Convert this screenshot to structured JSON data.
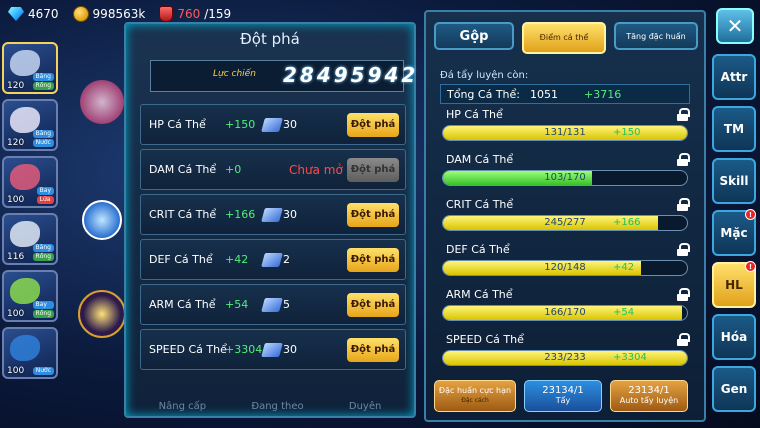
{
  "topbar": {
    "gems": "4670",
    "gold": "998563k",
    "stamina": "760",
    "stamina_max": "/159"
  },
  "heroes": [
    {
      "level": "120",
      "tags": [
        "Băng",
        "Rồng"
      ],
      "color": "#c6d6f2",
      "selected": true
    },
    {
      "level": "120",
      "tags": [
        "Băng",
        "Nước"
      ],
      "color": "#e9e6f9",
      "selected": false
    },
    {
      "level": "100",
      "tags": [
        "Bay",
        "Lửa"
      ],
      "color": "#e05a7a",
      "selected": false
    },
    {
      "level": "116",
      "tags": [
        "Băng",
        "Rồng"
      ],
      "color": "#dfe7f5",
      "selected": false
    },
    {
      "level": "100",
      "tags": [
        "Bay",
        "Rồng"
      ],
      "color": "#8bd94f",
      "selected": false
    },
    {
      "level": "100",
      "tags": [
        "Nước"
      ],
      "color": "#2e7fd8",
      "selected": false
    }
  ],
  "breakthrough": {
    "title": "Đột phá",
    "power_label": "Lực chiến",
    "power_value": "28495942",
    "rows": [
      {
        "name": "HP Cá Thể",
        "bonus": "+150",
        "cost": "30",
        "button": "Đột phá",
        "locked": false
      },
      {
        "name": "DAM Cá Thể",
        "bonus": "+0",
        "status": "Chưa mở",
        "button": "Đột phá",
        "locked": true
      },
      {
        "name": "CRIT Cá Thể",
        "bonus": "+166",
        "cost": "30",
        "button": "Đột phá",
        "locked": false
      },
      {
        "name": "DEF Cá Thể",
        "bonus": "+42",
        "cost": "2",
        "button": "Đột phá",
        "locked": false
      },
      {
        "name": "ARM Cá Thể",
        "bonus": "+54",
        "cost": "5",
        "button": "Đột phá",
        "locked": false
      },
      {
        "name": "SPEED Cá Thể",
        "bonus": "+3304",
        "cost": "30",
        "button": "Đột phá",
        "locked": false
      }
    ],
    "bottom_nav": [
      "Nâng cấp",
      "Đang theo",
      "Duyên"
    ]
  },
  "individual": {
    "tabs": [
      "Gộp",
      "Điểm cá thể",
      "Tăng đặc huấn"
    ],
    "remaining_label": "Đá tẩy luyện còn:",
    "total_label": "Tổng Cá Thể:",
    "total_value": "1051",
    "total_plus": "+3716",
    "stats": [
      {
        "name": "HP Cá Thể",
        "current": 131,
        "max": 131,
        "plus": "+150",
        "text": "131/131"
      },
      {
        "name": "DAM Cá Thể",
        "current": 103,
        "max": 170,
        "plus": "",
        "text": "103/170"
      },
      {
        "name": "CRIT Cá Thể",
        "current": 245,
        "max": 277,
        "plus": "+166",
        "text": "245/277"
      },
      {
        "name": "DEF Cá Thể",
        "current": 120,
        "max": 148,
        "plus": "+42",
        "text": "120/148"
      },
      {
        "name": "ARM Cá Thể",
        "current": 166,
        "max": 170,
        "plus": "+54",
        "text": "166/170"
      },
      {
        "name": "SPEED Cá Thể",
        "current": 233,
        "max": 233,
        "plus": "+3304",
        "text": "233/233"
      }
    ],
    "actions": [
      {
        "top": "Đặc huấn cực hạn",
        "sub": "Đặc cách"
      },
      {
        "top": "23134/1",
        "sub": "Tẩy"
      },
      {
        "top": "23134/1",
        "sub": "Auto tẩy luyện"
      }
    ]
  },
  "right_menu": [
    {
      "label": "Attr",
      "badge": ""
    },
    {
      "label": "TM",
      "badge": ""
    },
    {
      "label": "Skill",
      "badge": ""
    },
    {
      "label": "Mặc",
      "badge": "!"
    },
    {
      "label": "HL",
      "badge": "!"
    },
    {
      "label": "Hóa",
      "badge": ""
    },
    {
      "label": "Gen",
      "badge": ""
    }
  ],
  "close_label": "✕"
}
